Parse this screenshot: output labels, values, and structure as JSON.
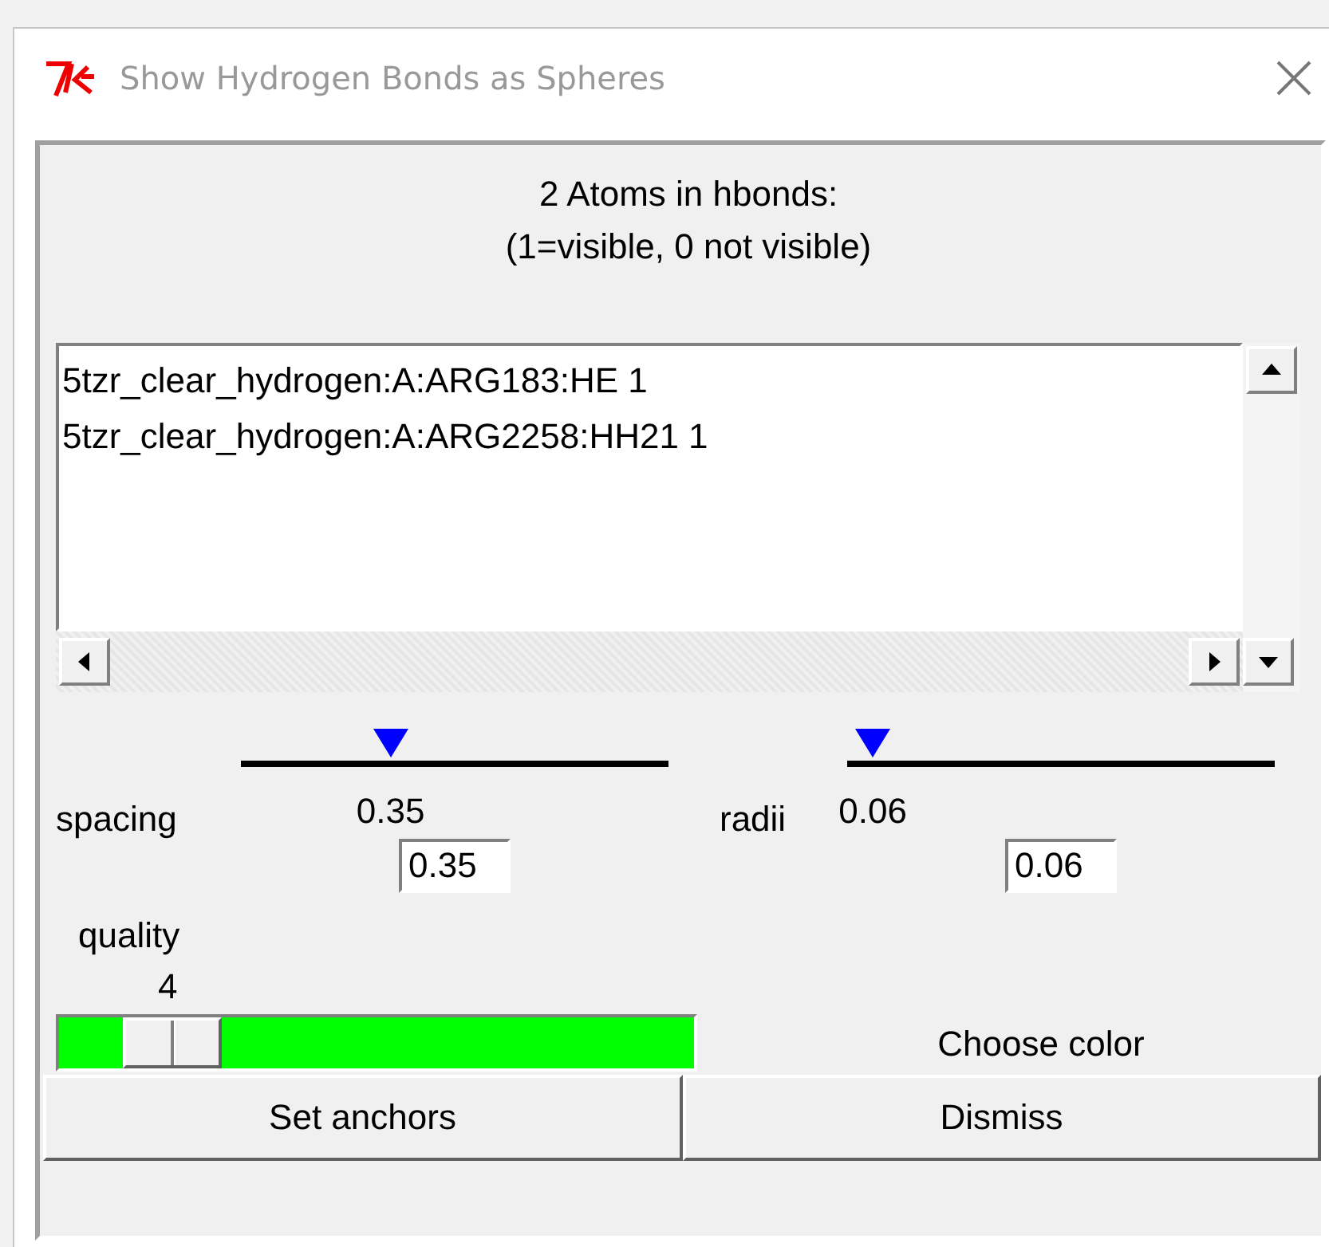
{
  "window": {
    "title": "Show Hydrogen Bonds as Spheres"
  },
  "header": {
    "line_1": "2 Atoms in hbonds:",
    "line_2": "(1=visible, 0 not visible)"
  },
  "atoms": [
    {
      "label": "5tzr_clear_hydrogen:A:ARG183:HE 1"
    },
    {
      "label": "5tzr_clear_hydrogen:A:ARG2258:HH21 1"
    }
  ],
  "scales": [
    {
      "label": "spacing",
      "level": 0.35,
      "reading": "0.35",
      "value": "0.35"
    },
    {
      "label": "radii",
      "level": 0.06,
      "reading": "0.06",
      "value": "0.06"
    }
  ],
  "quality": {
    "label": "quality",
    "reading": "4",
    "level": 0.12
  },
  "choose_color": {
    "label": "Choose color"
  },
  "buttons": [
    {
      "label": "Set anchors"
    },
    {
      "label": "Dismiss"
    }
  ]
}
